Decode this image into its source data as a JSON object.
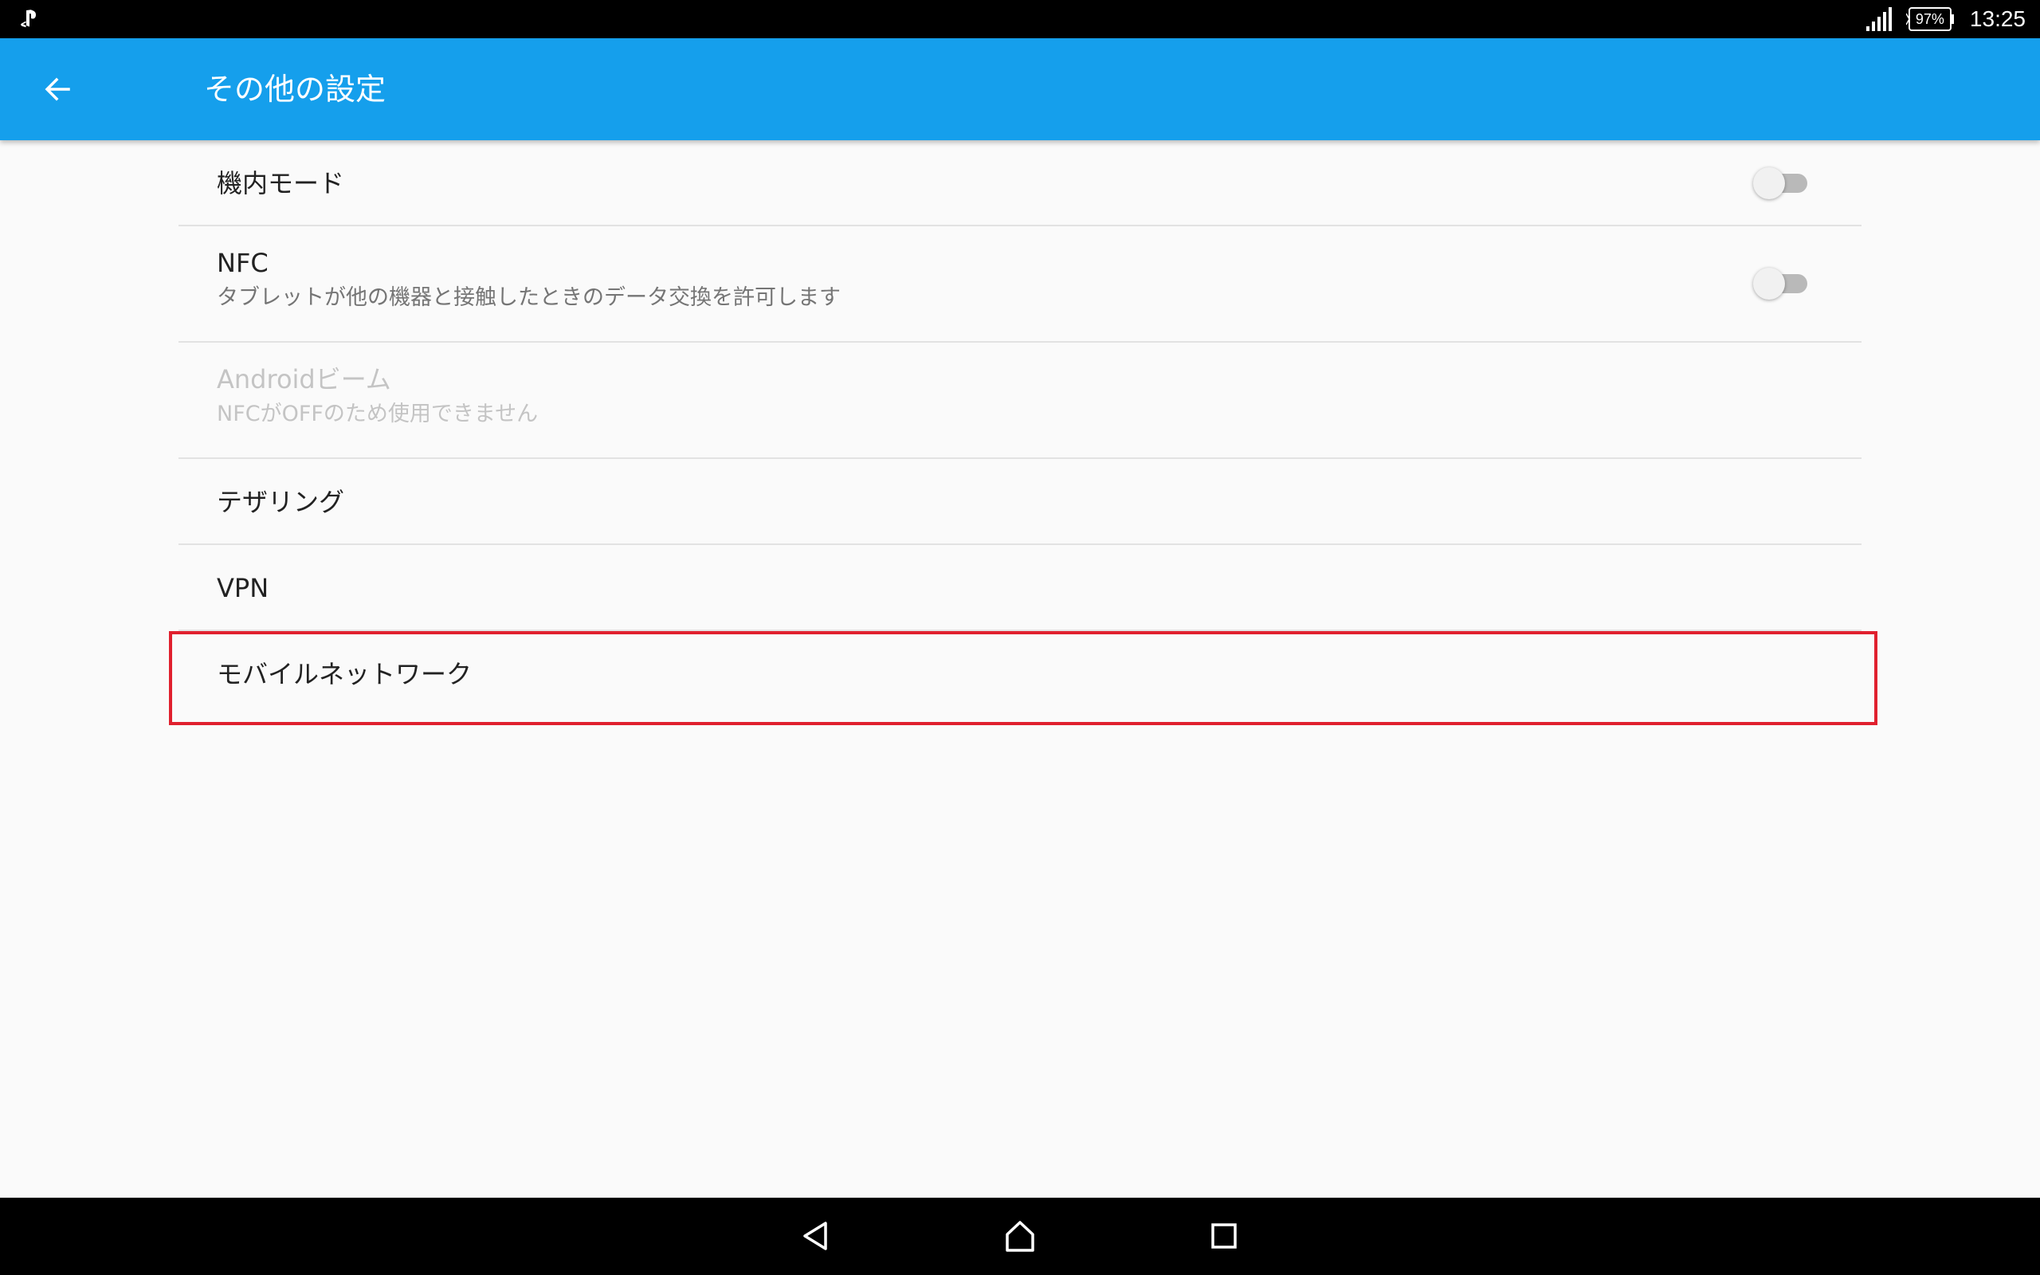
{
  "status_bar": {
    "left_icon": "playstation-icon",
    "battery": "97%",
    "time": "13:25",
    "icons": [
      "signal-icon",
      "battery-icon"
    ]
  },
  "app_bar": {
    "back_icon": "arrow-left-icon",
    "title": "その他の設定",
    "color": "#159fec"
  },
  "settings": {
    "airplane": {
      "title": "機内モード",
      "toggle_on": false
    },
    "nfc": {
      "title": "NFC",
      "subtitle": "タブレットが他の機器と接触したときのデータ交換を許可します",
      "toggle_on": false
    },
    "android_beam": {
      "title": "Androidビーム",
      "subtitle": "NFCがOFFのため使用できません",
      "enabled": false
    },
    "tethering": {
      "title": "テザリング"
    },
    "vpn": {
      "title": "VPN"
    },
    "mobile_network": {
      "title": "モバイルネットワーク",
      "highlighted": true
    }
  },
  "highlight_color": "#e0202e",
  "nav_bar": {
    "icons": [
      "back-triangle-icon",
      "home-icon",
      "recents-square-icon"
    ]
  }
}
